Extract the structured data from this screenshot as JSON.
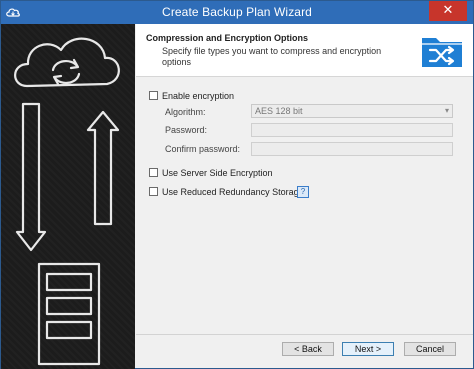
{
  "window": {
    "title": "Create Backup Plan Wizard",
    "close_glyph": "✕"
  },
  "header": {
    "title": "Compression and Encryption Options",
    "description": "Specify file types you want to compress and encryption options"
  },
  "encryption": {
    "checkbox_label": "Enable encryption",
    "algorithm_label": "Algorithm:",
    "algorithm_value": "AES 128 bit",
    "password_label": "Password:",
    "confirm_label": "Confirm password:"
  },
  "options": {
    "server_side_label": "Use Server Side Encryption",
    "reduced_redundancy_label": "Use Reduced Redundancy Storage",
    "help_glyph": "?"
  },
  "buttons": {
    "back": "< Back",
    "next": "Next >",
    "cancel": "Cancel"
  },
  "colors": {
    "titlebar": "#2f6db8",
    "close": "#c7352b",
    "accent": "#1f7fd4"
  }
}
